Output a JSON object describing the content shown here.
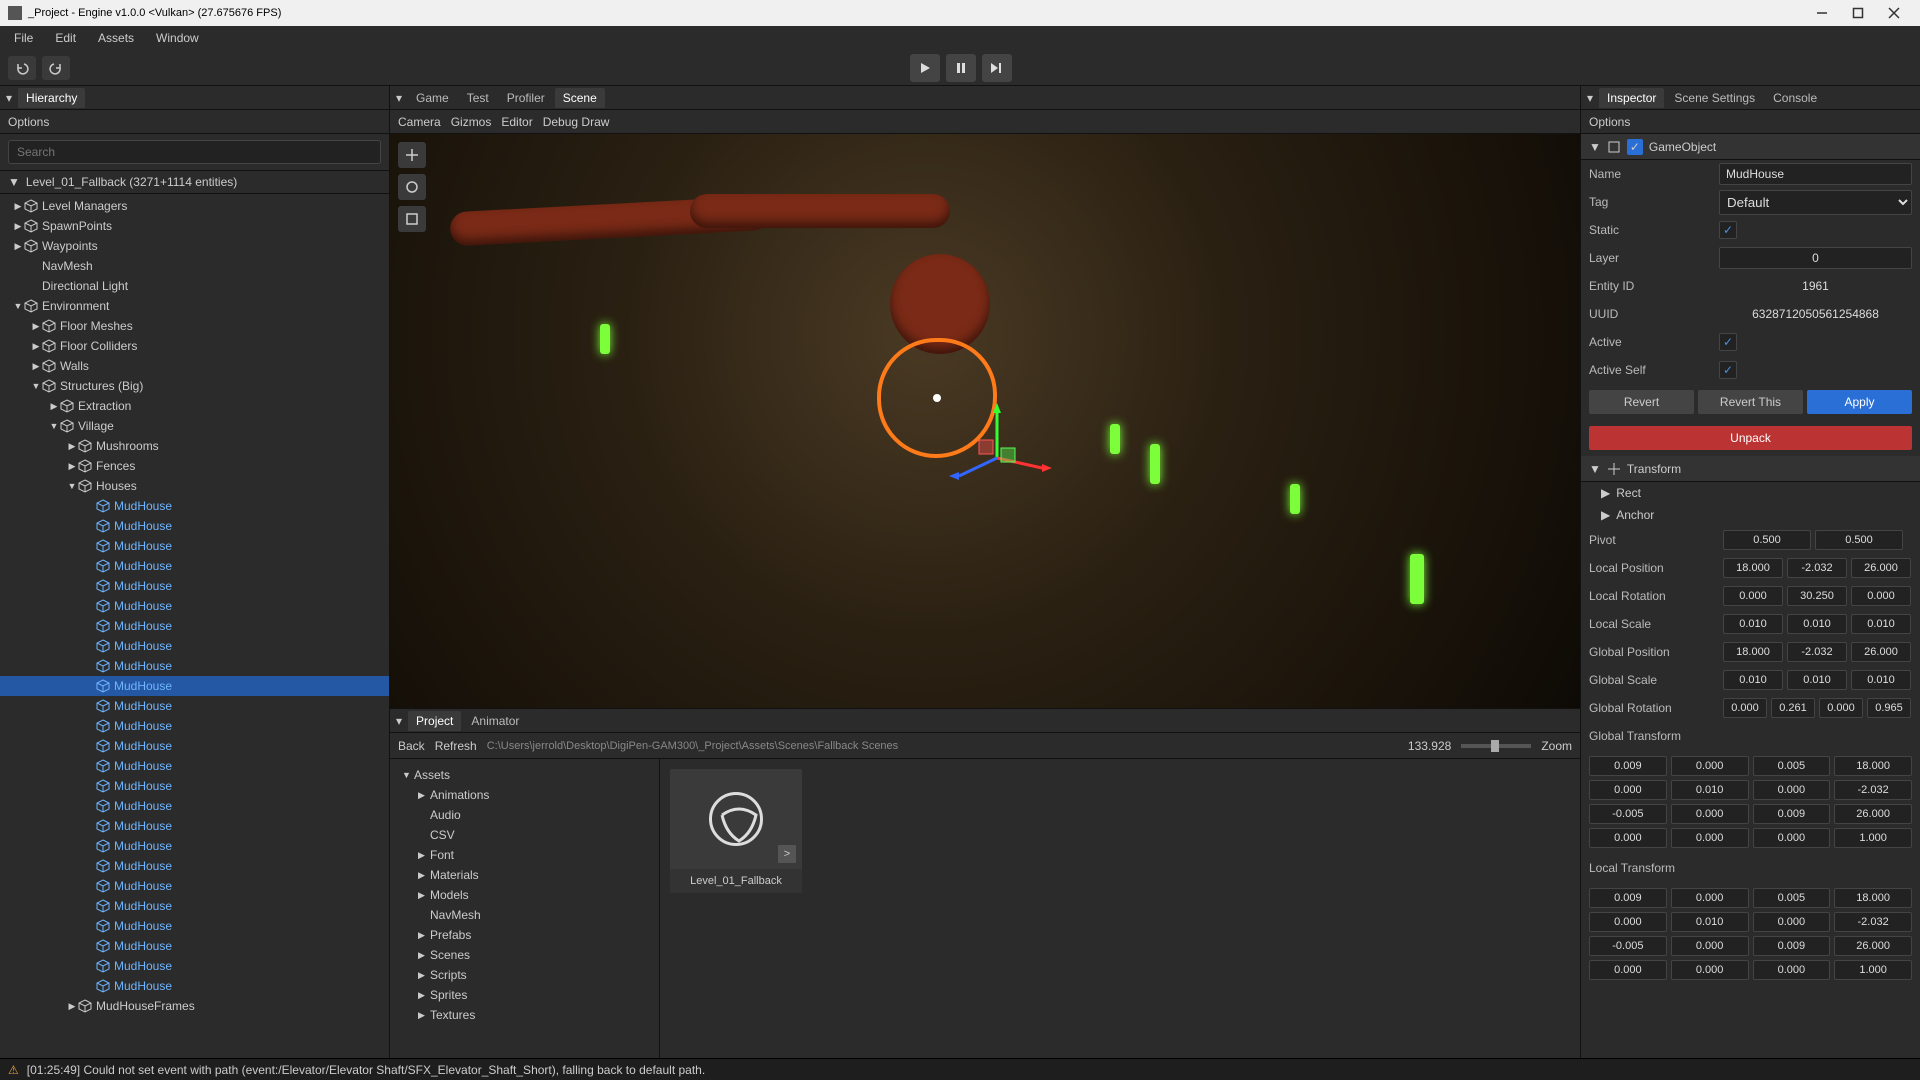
{
  "window": {
    "title": "_Project - Engine v1.0.0 <Vulkan> (27.675676 FPS)"
  },
  "menu": {
    "items": [
      "File",
      "Edit",
      "Assets",
      "Window"
    ]
  },
  "hierarchy": {
    "tab": "Hierarchy",
    "options": "Options",
    "search_placeholder": "Search",
    "scene_label": "Level_01_Fallback (3271+1114 entities)",
    "items": [
      {
        "depth": 0,
        "caret": "▶",
        "icon": "cube",
        "label": "Level Managers"
      },
      {
        "depth": 0,
        "caret": "▶",
        "icon": "cube",
        "label": "SpawnPoints"
      },
      {
        "depth": 0,
        "caret": "▶",
        "icon": "cube",
        "label": "Waypoints"
      },
      {
        "depth": 0,
        "caret": "",
        "icon": "none",
        "label": "NavMesh"
      },
      {
        "depth": 0,
        "caret": "",
        "icon": "none",
        "label": "Directional Light"
      },
      {
        "depth": 0,
        "caret": "▼",
        "icon": "cube",
        "label": "Environment"
      },
      {
        "depth": 1,
        "caret": "▶",
        "icon": "cube",
        "label": "Floor Meshes"
      },
      {
        "depth": 1,
        "caret": "▶",
        "icon": "cube",
        "label": "Floor Colliders"
      },
      {
        "depth": 1,
        "caret": "▶",
        "icon": "cube",
        "label": "Walls"
      },
      {
        "depth": 1,
        "caret": "▼",
        "icon": "cube",
        "label": "Structures (Big)"
      },
      {
        "depth": 2,
        "caret": "▶",
        "icon": "cube",
        "label": "Extraction"
      },
      {
        "depth": 2,
        "caret": "▼",
        "icon": "cube",
        "label": "Village"
      },
      {
        "depth": 3,
        "caret": "▶",
        "icon": "cube",
        "label": "Mushrooms"
      },
      {
        "depth": 3,
        "caret": "▶",
        "icon": "cube",
        "label": "Fences"
      },
      {
        "depth": 3,
        "caret": "▼",
        "icon": "cube",
        "label": "Houses"
      },
      {
        "depth": 4,
        "caret": "",
        "icon": "prefab",
        "label": "MudHouse"
      },
      {
        "depth": 4,
        "caret": "",
        "icon": "prefab",
        "label": "MudHouse"
      },
      {
        "depth": 4,
        "caret": "",
        "icon": "prefab",
        "label": "MudHouse"
      },
      {
        "depth": 4,
        "caret": "",
        "icon": "prefab",
        "label": "MudHouse"
      },
      {
        "depth": 4,
        "caret": "",
        "icon": "prefab",
        "label": "MudHouse"
      },
      {
        "depth": 4,
        "caret": "",
        "icon": "prefab",
        "label": "MudHouse"
      },
      {
        "depth": 4,
        "caret": "",
        "icon": "prefab",
        "label": "MudHouse"
      },
      {
        "depth": 4,
        "caret": "",
        "icon": "prefab",
        "label": "MudHouse"
      },
      {
        "depth": 4,
        "caret": "",
        "icon": "prefab",
        "label": "MudHouse"
      },
      {
        "depth": 4,
        "caret": "",
        "icon": "prefab",
        "label": "MudHouse",
        "selected": true
      },
      {
        "depth": 4,
        "caret": "",
        "icon": "prefab",
        "label": "MudHouse"
      },
      {
        "depth": 4,
        "caret": "",
        "icon": "prefab",
        "label": "MudHouse"
      },
      {
        "depth": 4,
        "caret": "",
        "icon": "prefab",
        "label": "MudHouse"
      },
      {
        "depth": 4,
        "caret": "",
        "icon": "prefab",
        "label": "MudHouse"
      },
      {
        "depth": 4,
        "caret": "",
        "icon": "prefab",
        "label": "MudHouse"
      },
      {
        "depth": 4,
        "caret": "",
        "icon": "prefab",
        "label": "MudHouse"
      },
      {
        "depth": 4,
        "caret": "",
        "icon": "prefab",
        "label": "MudHouse"
      },
      {
        "depth": 4,
        "caret": "",
        "icon": "prefab",
        "label": "MudHouse"
      },
      {
        "depth": 4,
        "caret": "",
        "icon": "prefab",
        "label": "MudHouse"
      },
      {
        "depth": 4,
        "caret": "",
        "icon": "prefab",
        "label": "MudHouse"
      },
      {
        "depth": 4,
        "caret": "",
        "icon": "prefab",
        "label": "MudHouse"
      },
      {
        "depth": 4,
        "caret": "",
        "icon": "prefab",
        "label": "MudHouse"
      },
      {
        "depth": 4,
        "caret": "",
        "icon": "prefab",
        "label": "MudHouse"
      },
      {
        "depth": 4,
        "caret": "",
        "icon": "prefab",
        "label": "MudHouse"
      },
      {
        "depth": 4,
        "caret": "",
        "icon": "prefab",
        "label": "MudHouse"
      },
      {
        "depth": 3,
        "caret": "▶",
        "icon": "cube",
        "label": "MudHouseFrames"
      }
    ]
  },
  "center": {
    "tabs": [
      "Game",
      "Test",
      "Profiler",
      "Scene"
    ],
    "active_tab": "Scene",
    "toolbar": [
      "Camera",
      "Gizmos",
      "Editor",
      "Debug Draw"
    ]
  },
  "project": {
    "tabs": [
      "Project",
      "Animator"
    ],
    "active_tab": "Project",
    "back": "Back",
    "refresh": "Refresh",
    "path": "C:\\Users\\jerrold\\Desktop\\DigiPen-GAM300\\_Project\\Assets\\Scenes\\Fallback Scenes",
    "zoom_value": "133.928",
    "zoom_label": "Zoom",
    "tree": [
      {
        "depth": 0,
        "caret": "▼",
        "label": "Assets"
      },
      {
        "depth": 1,
        "caret": "▶",
        "label": "Animations"
      },
      {
        "depth": 1,
        "caret": "",
        "label": "Audio"
      },
      {
        "depth": 1,
        "caret": "",
        "label": "CSV"
      },
      {
        "depth": 1,
        "caret": "▶",
        "label": "Font"
      },
      {
        "depth": 1,
        "caret": "▶",
        "label": "Materials"
      },
      {
        "depth": 1,
        "caret": "▶",
        "label": "Models"
      },
      {
        "depth": 1,
        "caret": "",
        "label": "NavMesh"
      },
      {
        "depth": 1,
        "caret": "▶",
        "label": "Prefabs"
      },
      {
        "depth": 1,
        "caret": "▶",
        "label": "Scenes"
      },
      {
        "depth": 1,
        "caret": "▶",
        "label": "Scripts"
      },
      {
        "depth": 1,
        "caret": "▶",
        "label": "Sprites"
      },
      {
        "depth": 1,
        "caret": "▶",
        "label": "Textures"
      }
    ],
    "asset": {
      "label": "Level_01_Fallback",
      "ext": ">"
    }
  },
  "inspector": {
    "tabs": [
      "Inspector",
      "Scene Settings",
      "Console"
    ],
    "active_tab": "Inspector",
    "options": "Options",
    "go_label": "GameObject",
    "name_label": "Name",
    "name_value": "MudHouse",
    "tag_label": "Tag",
    "tag_value": "Default",
    "static_label": "Static",
    "layer_label": "Layer",
    "layer_value": "0",
    "entity_label": "Entity ID",
    "entity_value": "1961",
    "uuid_label": "UUID",
    "uuid_value": "6328712050561254868",
    "active_label": "Active",
    "active_self_label": "Active Self",
    "revert": "Revert",
    "revert_this": "Revert This",
    "apply": "Apply",
    "unpack": "Unpack",
    "transform_label": "Transform",
    "rect_label": "Rect",
    "anchor_label": "Anchor",
    "pivot_label": "Pivot",
    "pivot": [
      "0.500",
      "0.500"
    ],
    "lpos_label": "Local Position",
    "lpos": [
      "18.000",
      "-2.032",
      "26.000"
    ],
    "lrot_label": "Local Rotation",
    "lrot": [
      "0.000",
      "30.250",
      "0.000"
    ],
    "lscl_label": "Local Scale",
    "lscl": [
      "0.010",
      "0.010",
      "0.010"
    ],
    "gpos_label": "Global Position",
    "gpos": [
      "18.000",
      "-2.032",
      "26.000"
    ],
    "gscl_label": "Global Scale",
    "gscl": [
      "0.010",
      "0.010",
      "0.010"
    ],
    "grot_label": "Global Rotation",
    "grot": [
      "0.000",
      "0.261",
      "0.000",
      "0.965"
    ],
    "gtrans_label": "Global Transform",
    "gmatrix": [
      [
        "0.009",
        "0.000",
        "0.005",
        "18.000"
      ],
      [
        "0.000",
        "0.010",
        "0.000",
        "-2.032"
      ],
      [
        "-0.005",
        "0.000",
        "0.009",
        "26.000"
      ],
      [
        "0.000",
        "0.000",
        "0.000",
        "1.000"
      ]
    ],
    "ltrans_label": "Local Transform",
    "lmatrix": [
      [
        "0.009",
        "0.000",
        "0.005",
        "18.000"
      ],
      [
        "0.000",
        "0.010",
        "0.000",
        "-2.032"
      ],
      [
        "-0.005",
        "0.000",
        "0.009",
        "26.000"
      ],
      [
        "0.000",
        "0.000",
        "0.000",
        "1.000"
      ]
    ]
  },
  "status": {
    "text": "[01:25:49] Could not set event with path (event:/Elevator/Elevator Shaft/SFX_Elevator_Shaft_Short), falling back to default path."
  }
}
